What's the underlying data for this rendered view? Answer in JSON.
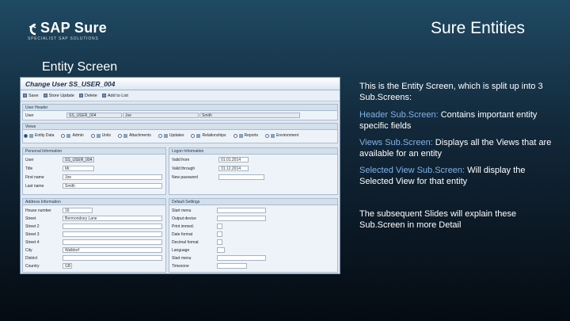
{
  "logo": {
    "name": "SAP Sure",
    "tagline": "SPECIALIST SAP SOLUTIONS"
  },
  "slide_title": "Sure Entities",
  "screen_label": "Entity Screen",
  "sap": {
    "title": "Change User SS_USER_004",
    "toolbar": [
      {
        "label": "Save",
        "icon": "save-icon"
      },
      {
        "label": "Store Update",
        "icon": "store-update-icon"
      },
      {
        "label": "Delete",
        "icon": "delete-icon"
      },
      {
        "label": "Add to List",
        "icon": "add-to-list-icon"
      }
    ],
    "user_header": {
      "title": "User Header",
      "label": "User",
      "id": "SS_USER_004",
      "first": "Joe",
      "last": "Smith"
    },
    "views": {
      "title": "Views",
      "items": [
        "Entity Data",
        "Admin",
        "Units",
        "Attachments",
        "Updates",
        "Relationships",
        "Reports",
        "Environment"
      ]
    },
    "personal": {
      "title": "Personal Information",
      "rows": [
        {
          "label": "User",
          "value": "SS_USER_004"
        },
        {
          "label": "Title",
          "value": "Mr."
        },
        {
          "label": "First name",
          "value": "Joe"
        },
        {
          "label": "Last name",
          "value": "Smith"
        }
      ]
    },
    "logon": {
      "title": "Logon Information",
      "rows": [
        {
          "label": "Valid from",
          "value": "01.01.2014"
        },
        {
          "label": "Valid through",
          "value": "31.12.2014"
        },
        {
          "label": "New password",
          "value": ""
        }
      ]
    },
    "address": {
      "title": "Address Information",
      "rows": [
        {
          "label": "House number",
          "value": "16"
        },
        {
          "label": "Street",
          "value": "Bermondsey Lane"
        },
        {
          "label": "Street 2",
          "value": ""
        },
        {
          "label": "Street 3",
          "value": ""
        },
        {
          "label": "Street 4",
          "value": ""
        },
        {
          "label": "City",
          "value": "Walldorf"
        },
        {
          "label": "District",
          "value": ""
        },
        {
          "label": "Country",
          "value": "GB"
        }
      ]
    },
    "defaults": {
      "title": "Default Settings",
      "rows": [
        {
          "label": "Start menu",
          "value": ""
        },
        {
          "label": "Output device",
          "value": ""
        },
        {
          "label": "Print immed.",
          "value": ""
        },
        {
          "label": "Date format",
          "value": ""
        },
        {
          "label": "Decimal format",
          "value": ""
        },
        {
          "label": "Language",
          "value": ""
        },
        {
          "label": "Start menu",
          "value": ""
        },
        {
          "label": "Timezone",
          "value": ""
        }
      ]
    }
  },
  "description": {
    "intro": "This is the Entity Screen, which is split up into 3 Sub.Screens:",
    "header_term": "Header Sub.Screen:",
    "header_text": " Contains important entity specific fields",
    "views_term": "Views Sub.Screen:",
    "views_text": " Displays all the Views that are available for an entity",
    "selected_term": "Selected View Sub.Screen:",
    "selected_text": " Will display the Selected View for that entity",
    "outro": "The subsequent Slides will explain these Sub.Screen in more Detail"
  },
  "colors": {
    "highlight": "#7fb3ea"
  }
}
